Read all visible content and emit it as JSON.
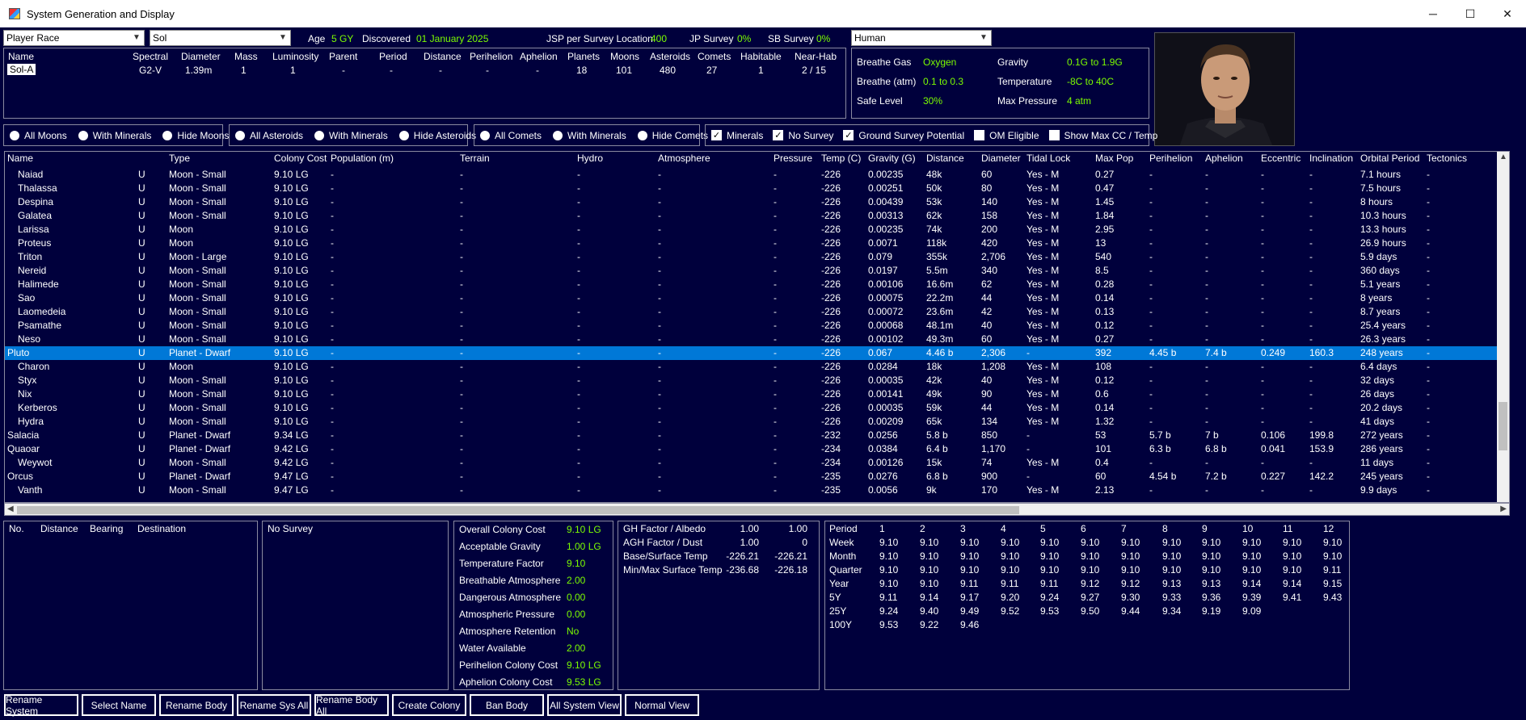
{
  "window": {
    "title": "System Generation and Display",
    "minimize": "─",
    "maximize": "☐",
    "close": "✕"
  },
  "top": {
    "race_combo": "Player Race",
    "system_combo": "Sol",
    "age_label": "Age",
    "age_value": "5 GY",
    "discovered_label": "Discovered",
    "discovered_value": "01 January 2025",
    "jsp_label": "JSP per Survey Location",
    "jsp_value": "400",
    "jp_label": "JP Survey",
    "jp_value": "0%",
    "sb_label": "SB Survey",
    "sb_value": "0%",
    "species_combo": "Human"
  },
  "summary": {
    "headers": [
      "Name",
      "Spectral",
      "Diameter",
      "Mass",
      "Luminosity",
      "Parent",
      "Period",
      "Distance",
      "Perihelion",
      "Aphelion",
      "Planets",
      "Moons",
      "Asteroids",
      "Comets",
      "Habitable",
      "Near-Hab"
    ],
    "values": [
      "Sol-A",
      "G2-V",
      "1.39m",
      "1",
      "1",
      "-",
      "-",
      "-",
      "-",
      "-",
      "18",
      "101",
      "480",
      "27",
      "1",
      "2 / 15"
    ]
  },
  "species_stats": {
    "breathe_gas_label": "Breathe Gas",
    "breathe_gas": "Oxygen",
    "gravity_label": "Gravity",
    "gravity": "0.1G  to  1.9G",
    "breathe_atm_label": "Breathe (atm)",
    "breathe_atm": "0.1  to  0.3",
    "temperature_label": "Temperature",
    "temperature": "-8C  to  40C",
    "safe_level_label": "Safe Level",
    "safe_level": "30%",
    "max_pressure_label": "Max Pressure",
    "max_pressure": "4 atm"
  },
  "filters": {
    "moons": [
      "All Moons",
      "With Minerals",
      "Hide Moons"
    ],
    "asteroids": [
      "All Asteroids",
      "With Minerals",
      "Hide Asteroids"
    ],
    "comets": [
      "All Comets",
      "With Minerals",
      "Hide Comets"
    ],
    "checks": [
      {
        "label": "Minerals",
        "checked": true
      },
      {
        "label": "No Survey",
        "checked": true
      },
      {
        "label": "Ground Survey Potential",
        "checked": true
      },
      {
        "label": "OM Eligible",
        "checked": false
      },
      {
        "label": "Show Max CC / Temp",
        "checked": false
      }
    ]
  },
  "grid": {
    "columns": [
      "Name",
      "Type",
      "Colony Cost",
      "Population (m)",
      "Terrain",
      "Hydro",
      "Atmosphere",
      "Pressure",
      "Temp (C)",
      "Gravity (G)",
      "Distance",
      "Diameter",
      "Tidal Lock",
      "Max Pop",
      "Perihelion",
      "Aphelion",
      "Eccentric",
      "Inclination",
      "Orbital Period",
      "Tectonics"
    ],
    "rows": [
      {
        "indent": true,
        "cells": [
          "Naiad",
          "U",
          "Moon - Small",
          "9.10 LG",
          "-",
          "-",
          "-",
          "-",
          "-",
          "-226",
          "0.00235",
          "48k",
          "60",
          "Yes - M",
          "0.27",
          "-",
          "-",
          "-",
          "-",
          "7.1 hours",
          "-"
        ]
      },
      {
        "indent": true,
        "cells": [
          "Thalassa",
          "U",
          "Moon - Small",
          "9.10 LG",
          "-",
          "-",
          "-",
          "-",
          "-",
          "-226",
          "0.00251",
          "50k",
          "80",
          "Yes - M",
          "0.47",
          "-",
          "-",
          "-",
          "-",
          "7.5 hours",
          "-"
        ]
      },
      {
        "indent": true,
        "cells": [
          "Despina",
          "U",
          "Moon - Small",
          "9.10 LG",
          "-",
          "-",
          "-",
          "-",
          "-",
          "-226",
          "0.00439",
          "53k",
          "140",
          "Yes - M",
          "1.45",
          "-",
          "-",
          "-",
          "-",
          "8 hours",
          "-"
        ]
      },
      {
        "indent": true,
        "cells": [
          "Galatea",
          "U",
          "Moon - Small",
          "9.10 LG",
          "-",
          "-",
          "-",
          "-",
          "-",
          "-226",
          "0.00313",
          "62k",
          "158",
          "Yes - M",
          "1.84",
          "-",
          "-",
          "-",
          "-",
          "10.3 hours",
          "-"
        ]
      },
      {
        "indent": true,
        "cells": [
          "Larissa",
          "U",
          "Moon",
          "9.10 LG",
          "-",
          "-",
          "-",
          "-",
          "-",
          "-226",
          "0.00235",
          "74k",
          "200",
          "Yes - M",
          "2.95",
          "-",
          "-",
          "-",
          "-",
          "13.3 hours",
          "-"
        ]
      },
      {
        "indent": true,
        "cells": [
          "Proteus",
          "U",
          "Moon",
          "9.10 LG",
          "-",
          "-",
          "-",
          "-",
          "-",
          "-226",
          "0.0071",
          "118k",
          "420",
          "Yes - M",
          "13",
          "-",
          "-",
          "-",
          "-",
          "26.9 hours",
          "-"
        ]
      },
      {
        "indent": true,
        "cells": [
          "Triton",
          "U",
          "Moon - Large",
          "9.10 LG",
          "-",
          "-",
          "-",
          "-",
          "-",
          "-226",
          "0.079",
          "355k",
          "2,706",
          "Yes - M",
          "540",
          "-",
          "-",
          "-",
          "-",
          "5.9 days",
          "-"
        ]
      },
      {
        "indent": true,
        "cells": [
          "Nereid",
          "U",
          "Moon - Small",
          "9.10 LG",
          "-",
          "-",
          "-",
          "-",
          "-",
          "-226",
          "0.0197",
          "5.5m",
          "340",
          "Yes - M",
          "8.5",
          "-",
          "-",
          "-",
          "-",
          "360 days",
          "-"
        ]
      },
      {
        "indent": true,
        "cells": [
          "Halimede",
          "U",
          "Moon - Small",
          "9.10 LG",
          "-",
          "-",
          "-",
          "-",
          "-",
          "-226",
          "0.00106",
          "16.6m",
          "62",
          "Yes - M",
          "0.28",
          "-",
          "-",
          "-",
          "-",
          "5.1 years",
          "-"
        ]
      },
      {
        "indent": true,
        "cells": [
          "Sao",
          "U",
          "Moon - Small",
          "9.10 LG",
          "-",
          "-",
          "-",
          "-",
          "-",
          "-226",
          "0.00075",
          "22.2m",
          "44",
          "Yes - M",
          "0.14",
          "-",
          "-",
          "-",
          "-",
          "8 years",
          "-"
        ]
      },
      {
        "indent": true,
        "cells": [
          "Laomedeia",
          "U",
          "Moon - Small",
          "9.10 LG",
          "-",
          "-",
          "-",
          "-",
          "-",
          "-226",
          "0.00072",
          "23.6m",
          "42",
          "Yes - M",
          "0.13",
          "-",
          "-",
          "-",
          "-",
          "8.7 years",
          "-"
        ]
      },
      {
        "indent": true,
        "cells": [
          "Psamathe",
          "U",
          "Moon - Small",
          "9.10 LG",
          "-",
          "-",
          "-",
          "-",
          "-",
          "-226",
          "0.00068",
          "48.1m",
          "40",
          "Yes - M",
          "0.12",
          "-",
          "-",
          "-",
          "-",
          "25.4 years",
          "-"
        ]
      },
      {
        "indent": true,
        "cells": [
          "Neso",
          "U",
          "Moon - Small",
          "9.10 LG",
          "-",
          "-",
          "-",
          "-",
          "-",
          "-226",
          "0.00102",
          "49.3m",
          "60",
          "Yes - M",
          "0.27",
          "-",
          "-",
          "-",
          "-",
          "26.3 years",
          "-"
        ]
      },
      {
        "indent": false,
        "selected": true,
        "cells": [
          "Pluto",
          "U",
          "Planet - Dwarf",
          "9.10 LG",
          "-",
          "-",
          "-",
          "-",
          "-",
          "-226",
          "0.067",
          "4.46 b",
          "2,306",
          "-",
          "392",
          "4.45 b",
          "7.4 b",
          "0.249",
          "160.3",
          "248 years",
          "-"
        ]
      },
      {
        "indent": true,
        "cells": [
          "Charon",
          "U",
          "Moon",
          "9.10 LG",
          "-",
          "-",
          "-",
          "-",
          "-",
          "-226",
          "0.0284",
          "18k",
          "1,208",
          "Yes - M",
          "108",
          "-",
          "-",
          "-",
          "-",
          "6.4 days",
          "-"
        ]
      },
      {
        "indent": true,
        "cells": [
          "Styx",
          "U",
          "Moon - Small",
          "9.10 LG",
          "-",
          "-",
          "-",
          "-",
          "-",
          "-226",
          "0.00035",
          "42k",
          "40",
          "Yes - M",
          "0.12",
          "-",
          "-",
          "-",
          "-",
          "32 days",
          "-"
        ]
      },
      {
        "indent": true,
        "cells": [
          "Nix",
          "U",
          "Moon - Small",
          "9.10 LG",
          "-",
          "-",
          "-",
          "-",
          "-",
          "-226",
          "0.00141",
          "49k",
          "90",
          "Yes - M",
          "0.6",
          "-",
          "-",
          "-",
          "-",
          "26 days",
          "-"
        ]
      },
      {
        "indent": true,
        "cells": [
          "Kerberos",
          "U",
          "Moon - Small",
          "9.10 LG",
          "-",
          "-",
          "-",
          "-",
          "-",
          "-226",
          "0.00035",
          "59k",
          "44",
          "Yes - M",
          "0.14",
          "-",
          "-",
          "-",
          "-",
          "20.2 days",
          "-"
        ]
      },
      {
        "indent": true,
        "cells": [
          "Hydra",
          "U",
          "Moon - Small",
          "9.10 LG",
          "-",
          "-",
          "-",
          "-",
          "-",
          "-226",
          "0.00209",
          "65k",
          "134",
          "Yes - M",
          "1.32",
          "-",
          "-",
          "-",
          "-",
          "41 days",
          "-"
        ]
      },
      {
        "indent": false,
        "cells": [
          "Salacia",
          "U",
          "Planet - Dwarf",
          "9.34 LG",
          "-",
          "-",
          "-",
          "-",
          "-",
          "-232",
          "0.0256",
          "5.8 b",
          "850",
          "-",
          "53",
          "5.7 b",
          "7 b",
          "0.106",
          "199.8",
          "272 years",
          "-"
        ]
      },
      {
        "indent": false,
        "cells": [
          "Quaoar",
          "U",
          "Planet - Dwarf",
          "9.42 LG",
          "-",
          "-",
          "-",
          "-",
          "-",
          "-234",
          "0.0384",
          "6.4 b",
          "1,170",
          "-",
          "101",
          "6.3 b",
          "6.8 b",
          "0.041",
          "153.9",
          "286 years",
          "-"
        ]
      },
      {
        "indent": true,
        "cells": [
          "Weywot",
          "U",
          "Moon - Small",
          "9.42 LG",
          "-",
          "-",
          "-",
          "-",
          "-",
          "-234",
          "0.00126",
          "15k",
          "74",
          "Yes - M",
          "0.4",
          "-",
          "-",
          "-",
          "-",
          "11 days",
          "-"
        ]
      },
      {
        "indent": false,
        "cells": [
          "Orcus",
          "U",
          "Planet - Dwarf",
          "9.47 LG",
          "-",
          "-",
          "-",
          "-",
          "-",
          "-235",
          "0.0276",
          "6.8 b",
          "900",
          "-",
          "60",
          "4.54 b",
          "7.2 b",
          "0.227",
          "142.2",
          "245 years",
          "-"
        ]
      },
      {
        "indent": true,
        "cells": [
          "Vanth",
          "U",
          "Moon - Small",
          "9.47 LG",
          "-",
          "-",
          "-",
          "-",
          "-",
          "-235",
          "0.0056",
          "9k",
          "170",
          "Yes - M",
          "2.13",
          "-",
          "-",
          "-",
          "-",
          "9.9 days",
          "-"
        ]
      }
    ]
  },
  "jump_panel": {
    "headers": [
      "No.",
      "Distance",
      "Bearing",
      "Destination"
    ]
  },
  "survey_panel": {
    "text": "No Survey"
  },
  "colony_panel": {
    "items": [
      {
        "label": "Overall Colony Cost",
        "value": "9.10 LG"
      },
      {
        "label": "Acceptable Gravity",
        "value": "1.00 LG"
      },
      {
        "label": "Temperature Factor",
        "value": "9.10"
      },
      {
        "label": "Breathable Atmosphere",
        "value": "2.00"
      },
      {
        "label": "Dangerous Atmosphere",
        "value": "0.00"
      },
      {
        "label": "Atmospheric Pressure",
        "value": "0.00"
      },
      {
        "label": "Atmosphere Retention",
        "value": "No"
      },
      {
        "label": "Water Available",
        "value": "2.00"
      },
      {
        "label": "Perihelion Colony Cost",
        "value": "9.10 LG"
      },
      {
        "label": "Aphelion Colony Cost",
        "value": "9.53 LG"
      }
    ]
  },
  "gh_panel": {
    "rows": [
      {
        "label": "GH Factor / Albedo",
        "a": "1.00",
        "b": "1.00"
      },
      {
        "label": "AGH Factor / Dust",
        "a": "1.00",
        "b": "0"
      },
      {
        "label": "Base/Surface Temp",
        "a": "-226.21",
        "b": "-226.21"
      },
      {
        "label": "Min/Max Surface Temp",
        "a": "-236.68",
        "b": "-226.18"
      }
    ]
  },
  "period_panel": {
    "header": [
      "Period",
      "1",
      "2",
      "3",
      "4",
      "5",
      "6",
      "7",
      "8",
      "9",
      "10",
      "11",
      "12"
    ],
    "rows": [
      [
        "Week",
        "9.10",
        "9.10",
        "9.10",
        "9.10",
        "9.10",
        "9.10",
        "9.10",
        "9.10",
        "9.10",
        "9.10",
        "9.10",
        "9.10"
      ],
      [
        "Month",
        "9.10",
        "9.10",
        "9.10",
        "9.10",
        "9.10",
        "9.10",
        "9.10",
        "9.10",
        "9.10",
        "9.10",
        "9.10",
        "9.10"
      ],
      [
        "Quarter",
        "9.10",
        "9.10",
        "9.10",
        "9.10",
        "9.10",
        "9.10",
        "9.10",
        "9.10",
        "9.10",
        "9.10",
        "9.10",
        "9.11"
      ],
      [
        "Year",
        "9.10",
        "9.10",
        "9.11",
        "9.11",
        "9.11",
        "9.12",
        "9.12",
        "9.13",
        "9.13",
        "9.14",
        "9.14",
        "9.15"
      ],
      [
        "5Y",
        "9.11",
        "9.14",
        "9.17",
        "9.20",
        "9.24",
        "9.27",
        "9.30",
        "9.33",
        "9.36",
        "9.39",
        "9.41",
        "9.43"
      ],
      [
        "25Y",
        "9.24",
        "9.40",
        "9.49",
        "9.52",
        "9.53",
        "9.50",
        "9.44",
        "9.34",
        "9.19",
        "9.09",
        "",
        ""
      ],
      [
        "100Y",
        "9.53",
        "9.22",
        "9.46",
        "",
        "",
        "",
        "",
        "",
        "",
        "",
        "",
        ""
      ]
    ]
  },
  "buttons": [
    "Rename System",
    "Select Name",
    "Rename Body",
    "Rename Sys All",
    "Rename Body All",
    "Create Colony",
    "Ban Body",
    "All System View",
    "Normal View"
  ]
}
